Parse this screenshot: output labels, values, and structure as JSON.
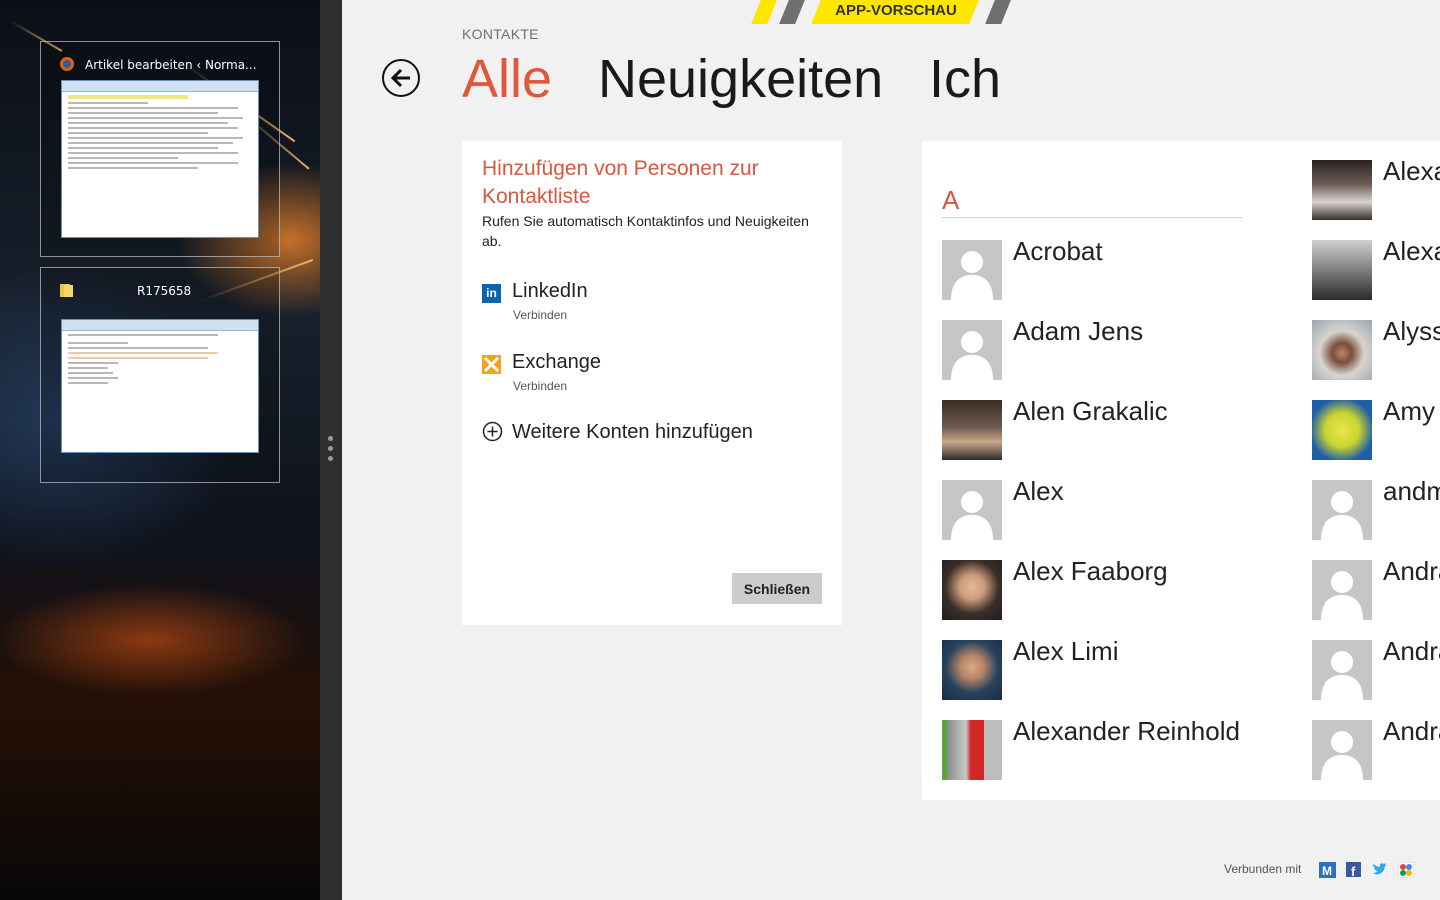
{
  "switcher": {
    "apps": [
      {
        "title": "Artikel bearbeiten ‹ Norma...",
        "icon": "firefox-icon"
      },
      {
        "title": "R175658",
        "icon": "folder-icon"
      }
    ]
  },
  "banner": {
    "label": "APP-VORSCHAU"
  },
  "header": {
    "breadcrumb": "KONTAKTE",
    "tabs": [
      {
        "label": "Alle",
        "active": true
      },
      {
        "label": "Neuigkeiten",
        "active": false
      },
      {
        "label": "Ich",
        "active": false
      }
    ]
  },
  "add_panel": {
    "title": "Hinzufügen von Personen zur Kontaktliste",
    "description": "Rufen Sie automatisch Kontaktinfos und Neuigkeiten ab.",
    "services": [
      {
        "name": "LinkedIn",
        "action": "Verbinden",
        "icon": "linkedin-icon"
      },
      {
        "name": "Exchange",
        "action": "Verbinden",
        "icon": "exchange-icon"
      }
    ],
    "more_accounts": "Weitere Konten hinzufügen",
    "close_label": "Schließen"
  },
  "contacts": {
    "group_letter": "A",
    "column1": [
      "Acrobat",
      "Adam Jens",
      "Alen Grakalic",
      "Alex",
      "Alex Faaborg",
      "Alex Limi",
      "Alexander Reinhold"
    ],
    "column2": [
      "Alexa",
      "Alexa",
      "Alyssa",
      "Amy",
      "andm",
      "Andra",
      "Andra",
      "Andra"
    ]
  },
  "footer": {
    "connected_label": "Verbunden mit",
    "networks": [
      "windows-live-icon",
      "facebook-icon",
      "twitter-icon",
      "google-icon"
    ]
  },
  "colors": {
    "accent": "#e0583b",
    "banner": "#ffe600"
  }
}
